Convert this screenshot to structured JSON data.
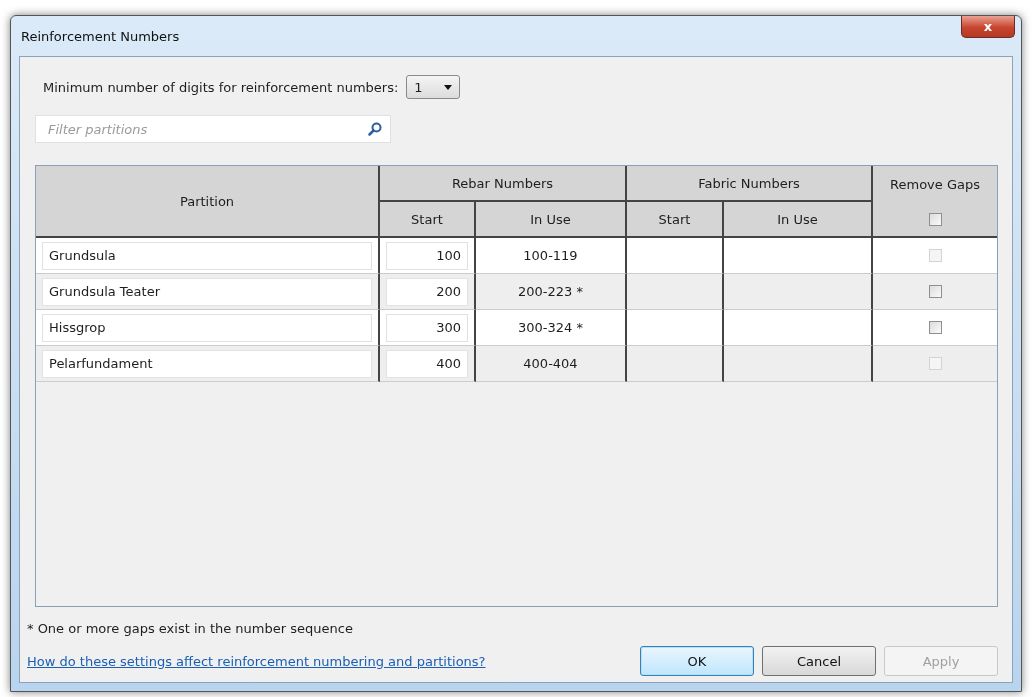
{
  "window": {
    "title": "Reinforcement Numbers",
    "close_label": "x"
  },
  "min_digits": {
    "label": "Minimum number of digits for reinforcement numbers:",
    "value": "1"
  },
  "filter": {
    "placeholder": "Filter partitions"
  },
  "table": {
    "columns": {
      "partition": "Partition",
      "rebar": "Rebar Numbers",
      "fabric": "Fabric Numbers",
      "remove_gaps": "Remove Gaps",
      "rebar_start": "Start",
      "rebar_in_use": "In Use",
      "fabric_start": "Start",
      "fabric_in_use": "In Use"
    },
    "header_checkbox": {
      "checked": false,
      "disabled": false
    },
    "rows": [
      {
        "partition": "Grundsula",
        "rebar_start": "100",
        "rebar_in_use": "100-119",
        "remove_gaps": {
          "checked": false,
          "disabled": true
        }
      },
      {
        "partition": "Grundsula Teater",
        "rebar_start": "200",
        "rebar_in_use": "200-223 *",
        "remove_gaps": {
          "checked": false,
          "disabled": false
        }
      },
      {
        "partition": "Hissgrop",
        "rebar_start": "300",
        "rebar_in_use": "300-324 *",
        "remove_gaps": {
          "checked": false,
          "disabled": false
        }
      },
      {
        "partition": "Pelarfundament",
        "rebar_start": "400",
        "rebar_in_use": "400-404",
        "remove_gaps": {
          "checked": false,
          "disabled": true
        }
      }
    ]
  },
  "footnote": "* One or more gaps exist in the number sequence",
  "help_link": "How do these settings affect reinforcement numbering and partitions?",
  "buttons": [
    {
      "label": "OK",
      "kind": "default",
      "disabled": false
    },
    {
      "label": "Cancel",
      "kind": "normal",
      "disabled": false
    },
    {
      "label": "Apply",
      "kind": "normal",
      "disabled": true
    }
  ]
}
